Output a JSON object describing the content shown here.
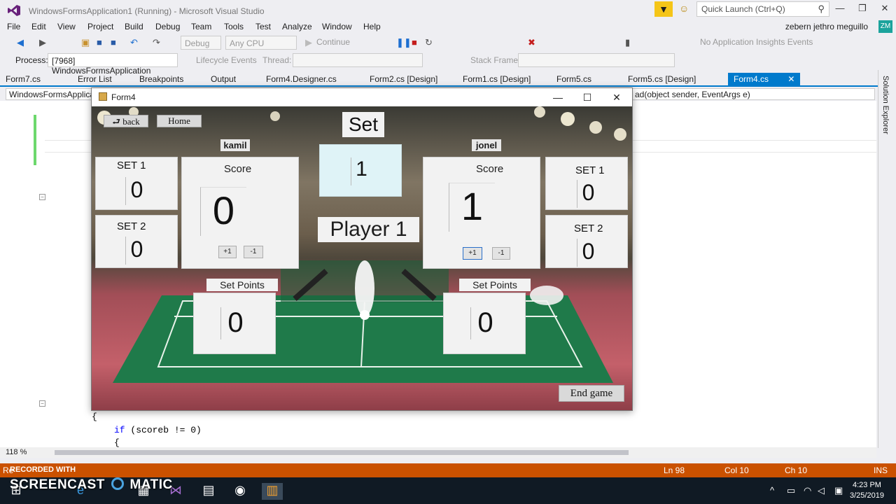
{
  "window": {
    "title": "WindowsFormsApplication1 (Running) - Microsoft Visual Studio",
    "quick_launch_placeholder": "Quick Launch (Ctrl+Q)",
    "user_name": "zebern jethro meguillo",
    "user_initials": "ZM"
  },
  "menu": [
    "File",
    "Edit",
    "View",
    "Project",
    "Build",
    "Debug",
    "Team",
    "Tools",
    "Test",
    "Analyze",
    "Window",
    "Help"
  ],
  "toolbar": {
    "config": "Debug",
    "platform": "Any CPU",
    "continue_label": "Continue",
    "insights": "No Application Insights Events",
    "process_label": "Process:",
    "process_value": "[7968] WindowsFormsApplication",
    "lifecycle_label": "Lifecycle Events",
    "thread_label": "Thread:",
    "stackframe_label": "Stack Frame:"
  },
  "tabs": [
    "Form7.cs",
    "Error List",
    "Breakpoints",
    "Output",
    "Form4.Designer.cs",
    "Form2.cs [Design]",
    "Form1.cs [Design]",
    "Form5.cs",
    "Form5.cs [Design]",
    "Form4.cs"
  ],
  "editor": {
    "left_nav": "WindowsFormsApplication1",
    "right_nav": "ad(object sender, EventArgs e)",
    "code_line1": "{",
    "code_line2_kw": "if",
    "code_line2_rest": " (scoreb != 0)",
    "code_line3": "{",
    "zoom": "118 %"
  },
  "solution_explorer_label": "Solution Explorer",
  "status": {
    "left": "Re",
    "ln": "Ln 98",
    "col": "Col 10",
    "ch": "Ch 10",
    "ins": "INS"
  },
  "watermark": {
    "recorded": "RECORDED WITH",
    "brand": "SCREENCAST",
    "brand2": "MATIC"
  },
  "taskbar": {
    "time": "4:23 PM",
    "date": "3/25/2019"
  },
  "form": {
    "title": "Form4",
    "back_label": "⮐ back",
    "home_label": "Home",
    "set_label": "Set",
    "set_value": "1",
    "current_player": "Player 1",
    "end_game_label": "End game",
    "left": {
      "name": "kamil",
      "set1_label": "SET 1",
      "set1_value": "0",
      "set2_label": "SET 2",
      "set2_value": "0",
      "score_label": "Score",
      "score_value": "0",
      "plus_label": "+1",
      "minus_label": "-1",
      "set_points_label": "Set Points",
      "set_points_value": "0"
    },
    "right": {
      "name": "jonel",
      "set1_label": "SET 1",
      "set1_value": "0",
      "set2_label": "SET 2",
      "set2_value": "0",
      "score_label": "Score",
      "score_value": "1",
      "plus_label": "+1",
      "minus_label": "-1",
      "set_points_label": "Set Points",
      "set_points_value": "0"
    }
  }
}
